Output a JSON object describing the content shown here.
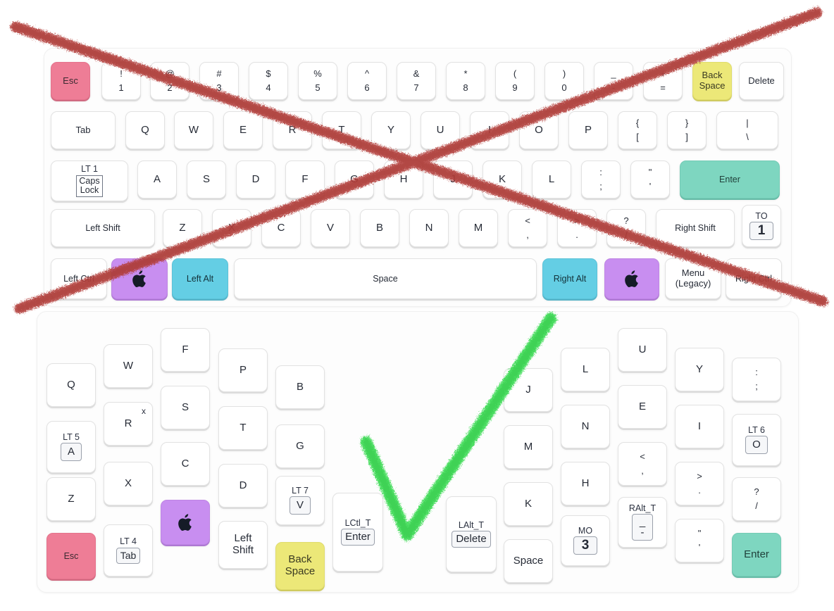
{
  "annotations": {
    "reject_mark": {
      "name": "red-x-cross-out",
      "color": "#b5413c",
      "target": "standard-qwerty-keyboard"
    },
    "accept_mark": {
      "name": "green-checkmark",
      "color": "#3ddc54",
      "target": "ergonomic-columnar-keyboard"
    }
  },
  "palette": {
    "key_face": "#ffffff",
    "key_edge": "#e2e2e2",
    "panel": "#fdfdfd",
    "escape_pink": "#ee7d96",
    "backspace_yellow": "#ece878",
    "enter_teal": "#7ed6c0",
    "gui_purple": "#c88ef0",
    "alt_cyan": "#64cee4",
    "legend": "#262b36"
  },
  "top_keyboard": {
    "name": "standard-qwerty-keyboard",
    "rows": [
      {
        "name": "number-row",
        "keys": [
          {
            "label": "Esc",
            "color": "pink"
          },
          {
            "top": "!",
            "bottom": "1"
          },
          {
            "top": "@",
            "bottom": "2"
          },
          {
            "top": "#",
            "bottom": "3"
          },
          {
            "top": "$",
            "bottom": "4"
          },
          {
            "top": "%",
            "bottom": "5"
          },
          {
            "top": "^",
            "bottom": "6"
          },
          {
            "top": "&",
            "bottom": "7"
          },
          {
            "top": "*",
            "bottom": "8"
          },
          {
            "top": "(",
            "bottom": "9"
          },
          {
            "top": ")",
            "bottom": "0"
          },
          {
            "top": "_",
            "bottom": "-"
          },
          {
            "top": "+",
            "bottom": "="
          },
          {
            "l1": "Back",
            "l2": "Space",
            "color": "yellow"
          },
          {
            "label": "Delete"
          }
        ]
      },
      {
        "name": "top-letter-row",
        "keys": [
          {
            "label": "Tab"
          },
          {
            "label": "Q"
          },
          {
            "label": "W"
          },
          {
            "label": "E"
          },
          {
            "label": "R"
          },
          {
            "label": "T"
          },
          {
            "label": "Y"
          },
          {
            "label": "U"
          },
          {
            "label": "I"
          },
          {
            "label": "O"
          },
          {
            "label": "P"
          },
          {
            "top": "{",
            "bottom": "["
          },
          {
            "top": "}",
            "bottom": "]"
          },
          {
            "top": "|",
            "bottom": "\\"
          }
        ]
      },
      {
        "name": "home-row",
        "keys": [
          {
            "layer": "LT 1",
            "sub_l1": "Caps",
            "sub_l2": "Lock"
          },
          {
            "label": "A"
          },
          {
            "label": "S"
          },
          {
            "label": "D"
          },
          {
            "label": "F"
          },
          {
            "label": "G"
          },
          {
            "label": "H"
          },
          {
            "label": "J"
          },
          {
            "label": "K"
          },
          {
            "label": "L"
          },
          {
            "top": ":",
            "bottom": ";"
          },
          {
            "top": "\"",
            "bottom": "'"
          },
          {
            "label": "Enter",
            "color": "teal"
          }
        ]
      },
      {
        "name": "bottom-letter-row",
        "keys": [
          {
            "label": "Left Shift"
          },
          {
            "label": "Z"
          },
          {
            "label": "X"
          },
          {
            "label": "C"
          },
          {
            "label": "V"
          },
          {
            "label": "B"
          },
          {
            "label": "N"
          },
          {
            "label": "M"
          },
          {
            "top": "<",
            "bottom": ","
          },
          {
            "top": ">",
            "bottom": "."
          },
          {
            "top": "?",
            "bottom": "/"
          },
          {
            "label": "Right Shift"
          },
          {
            "layer": "TO",
            "sub": "1"
          }
        ]
      },
      {
        "name": "modifier-row",
        "keys": [
          {
            "label": "Left Ctrl"
          },
          {
            "icon": "apple-logo-icon",
            "color": "purple"
          },
          {
            "label": "Left Alt",
            "color": "cyan"
          },
          {
            "label": "Space"
          },
          {
            "label": "Right Alt",
            "color": "cyan"
          },
          {
            "icon": "apple-logo-icon",
            "color": "purple"
          },
          {
            "l1": "Menu",
            "l2": "(Legacy)"
          },
          {
            "label": "Right Ctrl"
          }
        ]
      }
    ]
  },
  "bottom_keyboard": {
    "name": "ergonomic-columnar-keyboard",
    "left_half": {
      "columns": [
        {
          "name": "col-pinky",
          "keys": [
            {
              "label": "Q"
            },
            {
              "layer": "LT 5",
              "sub": "A"
            },
            {
              "label": "Z"
            },
            {
              "label": "Esc",
              "color": "pink"
            }
          ]
        },
        {
          "name": "col-ring",
          "keys": [
            {
              "label": "W"
            },
            {
              "label": "R",
              "sup": "x"
            },
            {
              "label": "X"
            },
            {
              "layer": "LT 4",
              "sub": "Tab"
            }
          ]
        },
        {
          "name": "col-middle",
          "keys": [
            {
              "label": "F"
            },
            {
              "label": "S"
            },
            {
              "label": "C"
            },
            {
              "icon": "apple-logo-icon",
              "color": "purple"
            }
          ]
        },
        {
          "name": "col-index",
          "keys": [
            {
              "label": "P"
            },
            {
              "label": "T"
            },
            {
              "label": "G"
            },
            {
              "label": "D"
            }
          ]
        },
        {
          "name": "col-inner",
          "keys": [
            {
              "label": "B"
            },
            {
              "label": "G"
            },
            {
              "layer": "LT 7",
              "sub": "V"
            },
            {
              "l1": "Back",
              "l2": "Space",
              "color": "yellow"
            }
          ]
        },
        {
          "name": "col-thumb",
          "keys": [
            {
              "layer": "LCtl_T",
              "sub": "Enter"
            }
          ]
        }
      ]
    },
    "right_half": {
      "columns": [
        {
          "name": "col-thumb",
          "keys": [
            {
              "layer": "LAlt_T",
              "sub": "Delete"
            }
          ]
        },
        {
          "name": "col-index",
          "keys": [
            {
              "label": "J"
            },
            {
              "label": "M"
            },
            {
              "label": "K"
            },
            {
              "label": "Space"
            }
          ]
        },
        {
          "name": "col-middle",
          "keys": [
            {
              "label": "L"
            },
            {
              "label": "N"
            },
            {
              "label": "H"
            },
            {
              "layer": "MO",
              "sub": "3"
            }
          ]
        },
        {
          "name": "col-ring",
          "keys": [
            {
              "label": "U"
            },
            {
              "label": "E"
            },
            {
              "top": "<",
              "bottom": ","
            },
            {
              "layer": "RAlt_T",
              "sub_top": "_",
              "sub_bottom": "-"
            }
          ]
        },
        {
          "name": "col-pinky",
          "keys": [
            {
              "label": "Y"
            },
            {
              "label": "I"
            },
            {
              "top": ">",
              "bottom": "."
            },
            {
              "top": "\"",
              "bottom": "'"
            }
          ]
        },
        {
          "name": "col-outer",
          "keys": [
            {
              "top": ":",
              "bottom": ";"
            },
            {
              "layer": "LT 6",
              "sub": "O"
            },
            {
              "top": "?",
              "bottom": "/"
            },
            {
              "label": "Enter",
              "color": "teal"
            }
          ]
        }
      ]
    }
  }
}
